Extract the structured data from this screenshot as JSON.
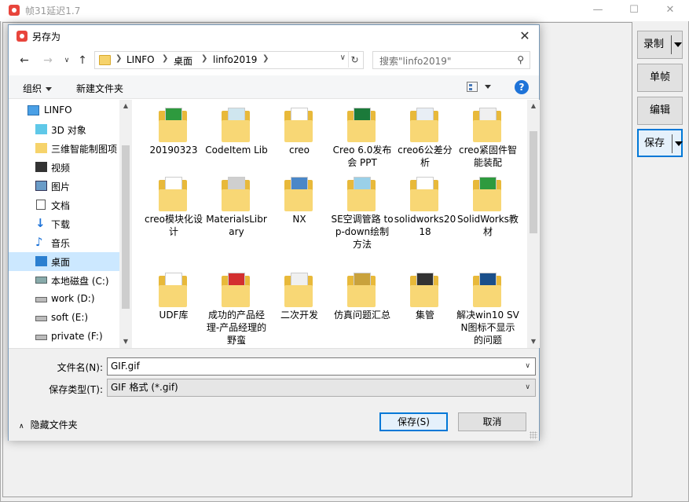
{
  "app": {
    "title": "帧31延迟1.7",
    "minimize": "—",
    "maximize": "☐",
    "close": "✕",
    "buttons": {
      "record": "录制",
      "single_frame": "单帧",
      "edit": "编辑",
      "save": "保存"
    }
  },
  "dialog": {
    "title": "另存为",
    "close": "✕",
    "breadcrumbs": [
      "LINFO",
      "桌面",
      "linfo2019"
    ],
    "search_placeholder": "搜索\"linfo2019\"",
    "toolbar": {
      "organize": "组织",
      "new_folder": "新建文件夹",
      "help": "?"
    },
    "nav_items": [
      {
        "label": "LINFO",
        "icon": "computer-icon"
      },
      {
        "label": "3D 对象",
        "icon": "3d-objects-icon"
      },
      {
        "label": "三维智能制图项",
        "icon": "folder-pin-icon"
      },
      {
        "label": "视频",
        "icon": "video-icon"
      },
      {
        "label": "图片",
        "icon": "pictures-icon"
      },
      {
        "label": "文档",
        "icon": "documents-icon"
      },
      {
        "label": "下载",
        "icon": "download-icon"
      },
      {
        "label": "音乐",
        "icon": "music-icon"
      },
      {
        "label": "桌面",
        "icon": "desktop-icon"
      },
      {
        "label": "本地磁盘 (C:)",
        "icon": "drive-c-icon"
      },
      {
        "label": "work (D:)",
        "icon": "drive-icon"
      },
      {
        "label": "soft (E:)",
        "icon": "drive-icon"
      },
      {
        "label": "private (F:)",
        "icon": "drive-icon"
      }
    ],
    "selected_nav": "桌面",
    "files": [
      "20190323",
      "CodeItem Lib",
      "creo",
      "Creo 6.0发布会 PPT",
      "creo6公差分析",
      "creo紧固件智能装配",
      "creo模块化设计",
      "MaterialsLibrary",
      "NX",
      "SE空调管路 top-down绘制方法",
      "solidworks2018",
      "SolidWorks教材",
      "UDF库",
      "成功的产品经理-产品经理的野蛮",
      "二次开发",
      "仿真问题汇总",
      "集管",
      "解决win10 SVN图标不显示的问题"
    ],
    "filename_label": "文件名(N):",
    "filename_value": "GIF.gif",
    "filetype_label": "保存类型(T):",
    "filetype_value": "GIF 格式 (*.gif)",
    "hide_folders": "隐藏文件夹",
    "save_button": "保存(S)",
    "cancel_button": "取消"
  },
  "colors": {
    "accent": "#0078d7",
    "selection": "#cce8ff",
    "folder": "#f8d775"
  }
}
